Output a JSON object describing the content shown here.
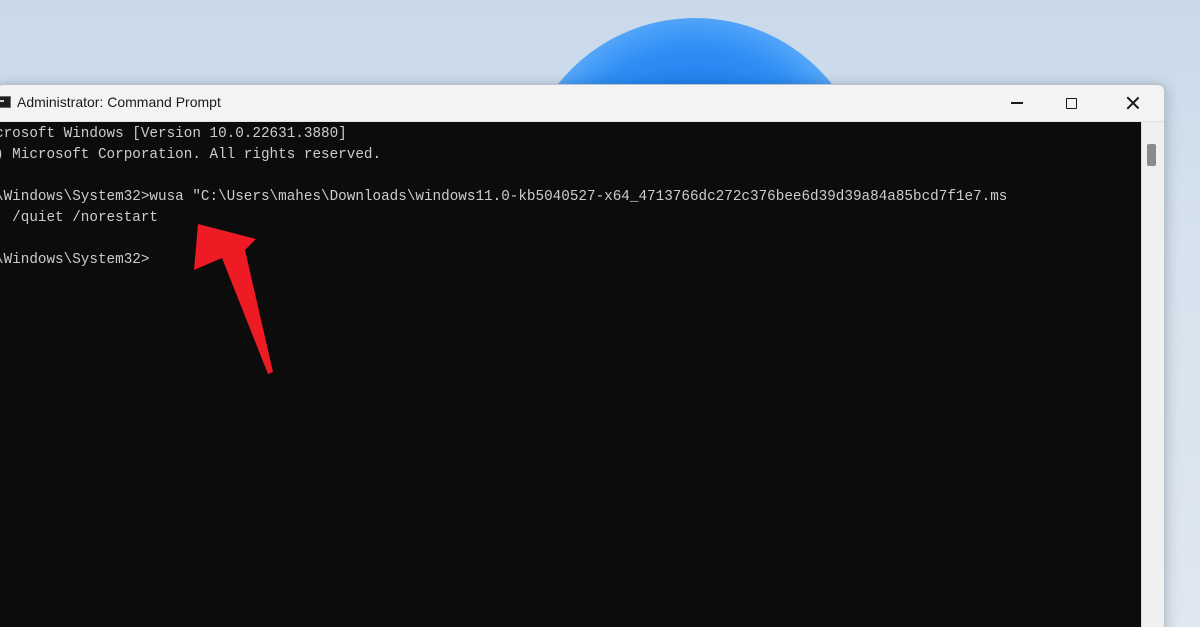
{
  "window": {
    "title": "Administrator: Command Prompt",
    "icon": "cmd-icon"
  },
  "controls": {
    "minimize_icon": "minimize-icon",
    "maximize_icon": "maximize-icon",
    "close_icon": "close-icon"
  },
  "console": {
    "lines": [
      "crosoft Windows [Version 10.0.22631.3880]",
      ") Microsoft Corporation. All rights reserved.",
      "",
      "\\Windows\\System32>wusa \"C:\\Users\\mahes\\Downloads\\windows11.0-kb5040527-x64_4713766dc272c376bee6d39d39a84a85bcd7f1e7.ms",
      "' /quiet /norestart",
      "",
      "\\Windows\\System32>"
    ],
    "text_color": "#cccccc",
    "background_color": "#0c0c0c"
  },
  "annotation": {
    "arrow_icon": "red-arrow-icon",
    "arrow_color": "#ee1b24"
  },
  "desktop": {
    "wallpaper_accent": "#1a76ea"
  }
}
